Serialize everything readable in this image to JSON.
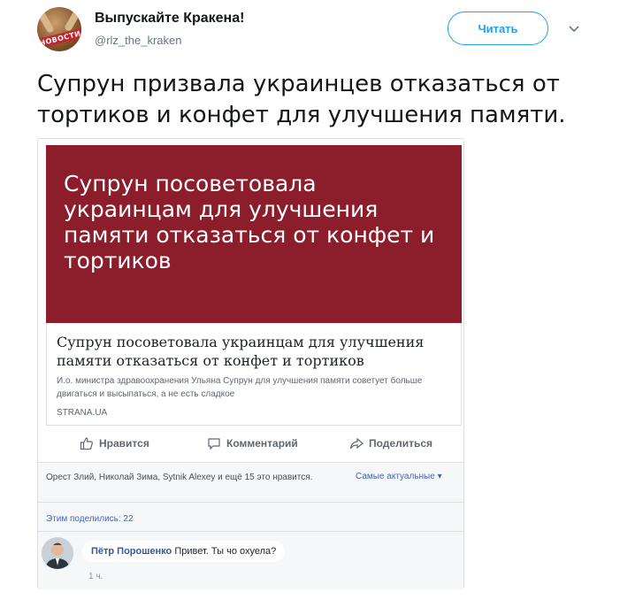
{
  "tweet": {
    "author_name": "Выпускайте Кракена!",
    "author_handle": "@rlz_the_kraken",
    "avatar_badge": "НОВОСТИ",
    "follow_label": "Читать",
    "text": "Супрун призвала украинцев отказаться от тортиков и конфет для улучшения памяти."
  },
  "fb_post": {
    "image_text": "Супрун посоветовала украинцам  для улучшения памяти отказаться от конфет и тортиков",
    "link_title": "Супрун посоветовала украинцам для улучшения памяти отказаться от конфет и тортиков",
    "link_description": "И.о. министра здравоохранения Ульяна Супрун для улучшения памяти советует больше двигаться и высыпаться, а не есть сладкое",
    "link_domain": "STRANA.UA",
    "actions": {
      "like": "Нравится",
      "comment": "Комментарий",
      "share": "Поделиться"
    },
    "likes_text": "Орест Злий, Николай Зима, Sytnik Alexey и ещё 15 это нравится.",
    "sort_label": "Самые актуальные ▾",
    "shares_text": "Этим поделились: 22",
    "comment": {
      "author": "Пётр Порошенко",
      "text": "Привет. Ты чо охуела?",
      "time": "1 ч."
    }
  },
  "colors": {
    "twitter_blue": "#1da1f2",
    "image_bg": "#8c1d2b",
    "fb_link": "#4267b2"
  }
}
